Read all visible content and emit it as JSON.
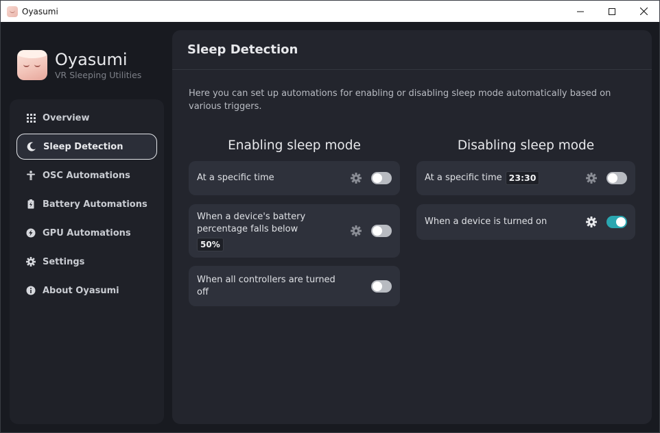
{
  "window": {
    "title": "Oyasumi"
  },
  "brand": {
    "title": "Oyasumi",
    "subtitle": "VR Sleeping Utilities"
  },
  "sidebar": {
    "items": [
      {
        "label": "Overview",
        "icon": "grid-icon",
        "active": false
      },
      {
        "label": "Sleep Detection",
        "icon": "moon-icon",
        "active": true
      },
      {
        "label": "OSC Automations",
        "icon": "person-icon",
        "active": false
      },
      {
        "label": "Battery Automations",
        "icon": "battery-icon",
        "active": false
      },
      {
        "label": "GPU Automations",
        "icon": "gpu-icon",
        "active": false
      },
      {
        "label": "Settings",
        "icon": "gear-icon",
        "active": false
      },
      {
        "label": "About Oyasumi",
        "icon": "info-icon",
        "active": false
      }
    ]
  },
  "main": {
    "title": "Sleep Detection",
    "description": "Here you can set up automations for enabling or disabling sleep mode automatically based on various triggers.",
    "enabling": {
      "title": "Enabling sleep mode",
      "cards": [
        {
          "label": "At a specific time",
          "enabled": false,
          "has_settings": true
        },
        {
          "label": "When a device's battery percentage falls below",
          "value": "50%",
          "enabled": false,
          "has_settings": true
        },
        {
          "label": "When all controllers are turned off",
          "enabled": false,
          "has_settings": false
        }
      ]
    },
    "disabling": {
      "title": "Disabling sleep mode",
      "cards": [
        {
          "label": "At a specific time",
          "value": "23:30",
          "enabled": false,
          "has_settings": true
        },
        {
          "label": "When a device is turned on",
          "enabled": true,
          "has_settings": true
        }
      ]
    }
  },
  "colors": {
    "accent": "#2aa6b0",
    "background": "#181a20",
    "panel": "#23252d",
    "card": "#2e313b"
  }
}
